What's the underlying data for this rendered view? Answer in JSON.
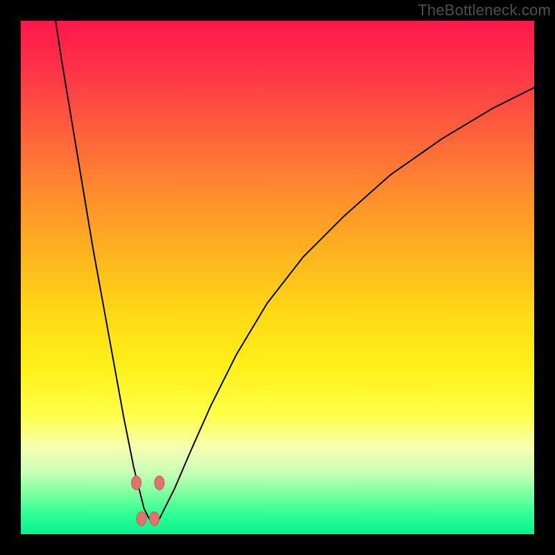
{
  "watermark": "TheBottleneck.com",
  "colors": {
    "curve": "#000000",
    "marker_fill": "#e0736e",
    "marker_stroke": "#c85a54",
    "frame": "#000000"
  },
  "chart_data": {
    "type": "line",
    "title": "",
    "xlabel": "",
    "ylabel": "",
    "xlim": [
      0,
      100
    ],
    "ylim": [
      0,
      100
    ],
    "x": [
      6,
      8,
      10,
      12,
      14,
      16,
      18,
      20,
      22,
      23,
      24,
      25,
      26,
      27,
      28,
      30,
      33,
      37,
      42,
      48,
      55,
      63,
      72,
      82,
      92,
      100
    ],
    "values": [
      105,
      92,
      80,
      68,
      56,
      45,
      34,
      23,
      13,
      9,
      5,
      3,
      2,
      3,
      5,
      9,
      16,
      25,
      35,
      45,
      54,
      62,
      70,
      77,
      83,
      87
    ],
    "markers": [
      {
        "x": 22.5,
        "y": 10
      },
      {
        "x": 27.0,
        "y": 10
      },
      {
        "x": 23.5,
        "y": 3
      },
      {
        "x": 26.0,
        "y": 3
      }
    ],
    "marker_size": 10
  }
}
